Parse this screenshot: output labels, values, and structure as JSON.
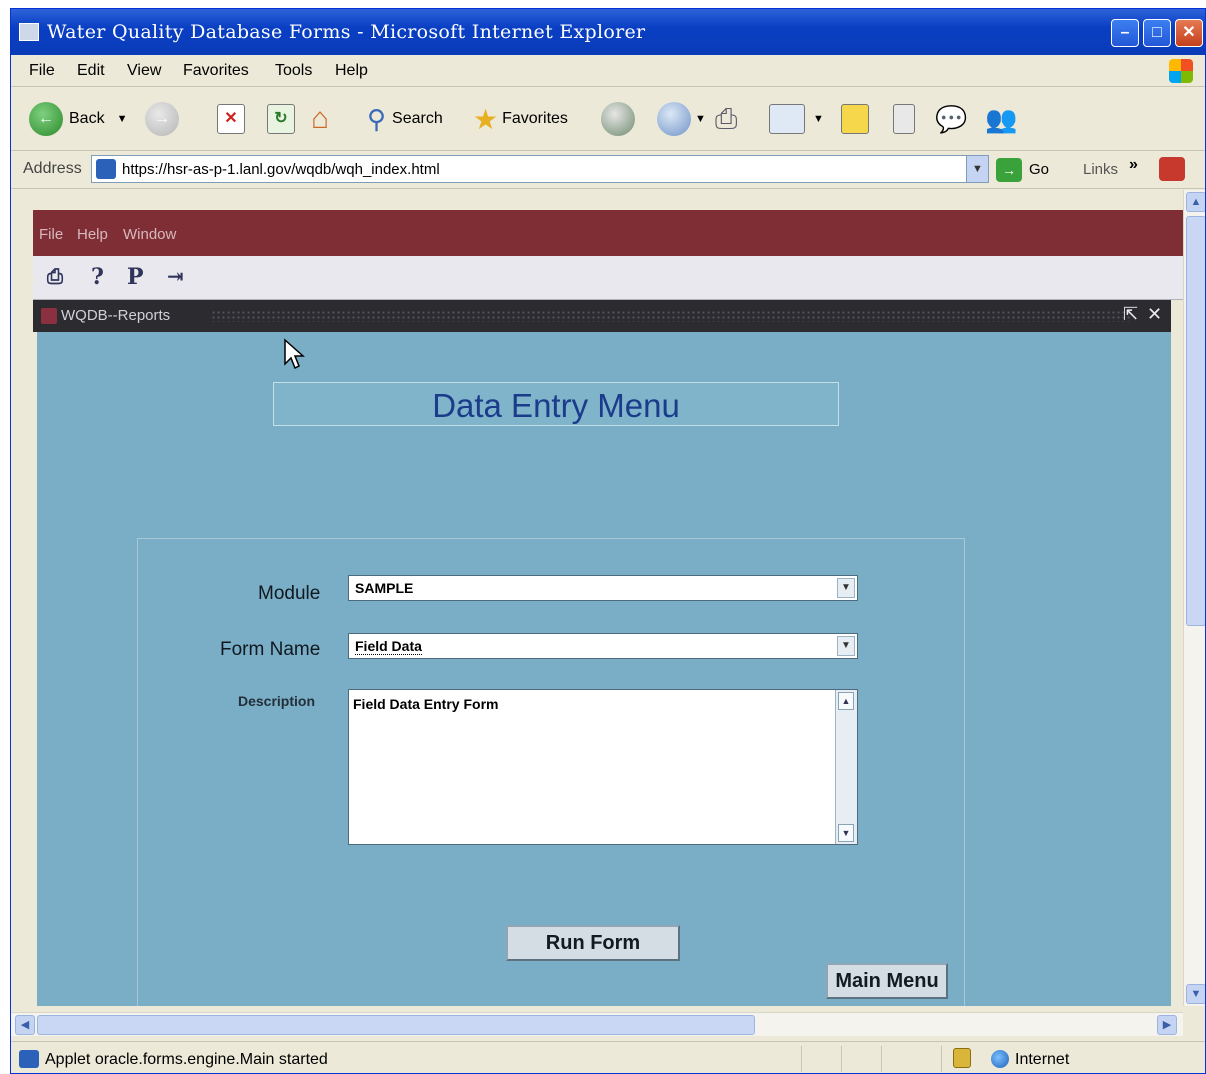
{
  "browser": {
    "title": "Water Quality Database Forms - Microsoft Internet Explorer",
    "menu": [
      "File",
      "Edit",
      "View",
      "Favorites",
      "Tools",
      "Help"
    ],
    "toolbar": {
      "back_label": "Back",
      "search_label": "Search",
      "favorites_label": "Favorites"
    },
    "address": {
      "label": "Address",
      "url": "https://hsr-as-p-1.lanl.gov/wqdb/wqh_index.html",
      "go_label": "Go",
      "links_label": "Links"
    },
    "status": {
      "text": "Applet oracle.forms.engine.Main started",
      "zone": "Internet"
    }
  },
  "applet": {
    "menu": [
      "File",
      "Help",
      "Window"
    ],
    "window_title": "WQDB--Reports",
    "heading": "Data Entry Menu",
    "form": {
      "module_label": "Module",
      "module_value": "SAMPLE",
      "form_name_label": "Form Name",
      "form_name_value": "Field Data",
      "description_label": "Description",
      "description_value": "Field Data Entry Form",
      "run_button": "Run Form",
      "main_menu_button": "Main Menu"
    }
  },
  "colors": {
    "ie_title_blue": "#0a3fc4",
    "oracle_menu_maroon": "#7f2e36",
    "canvas_teal": "#7aaec6",
    "heading_blue": "#1a3c8a"
  }
}
